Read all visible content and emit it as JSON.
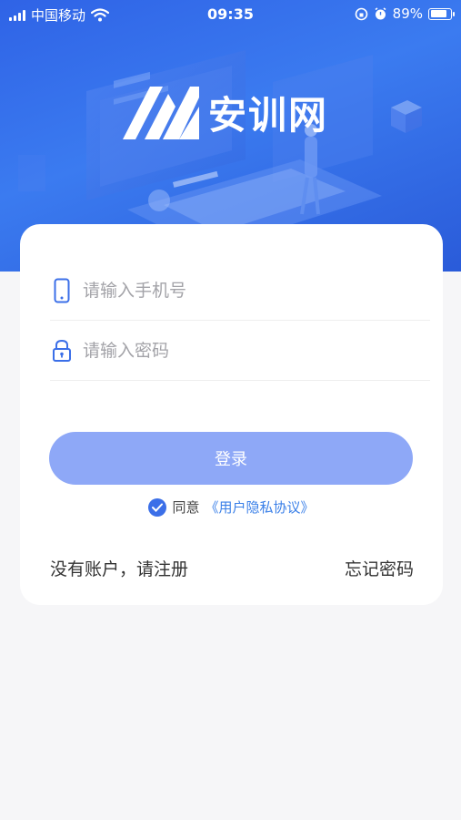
{
  "status_bar": {
    "carrier": "中国移动",
    "time": "09:35",
    "battery": "89%",
    "battery_level": 0.89
  },
  "brand": {
    "name": "安训网"
  },
  "form": {
    "phone_placeholder": "请输入手机号",
    "password_placeholder": "请输入密码",
    "login_label": "登录",
    "agree_text": "同意",
    "agreement_link": "《用户隐私协议》",
    "agreed": true
  },
  "links": {
    "register": "没有账户，请注册",
    "forgot_password": "忘记密码"
  },
  "colors": {
    "hero": "#3b7bf0",
    "button": "#8ea8f7",
    "link": "#3b80e8",
    "icon": "#3b6fe8"
  }
}
